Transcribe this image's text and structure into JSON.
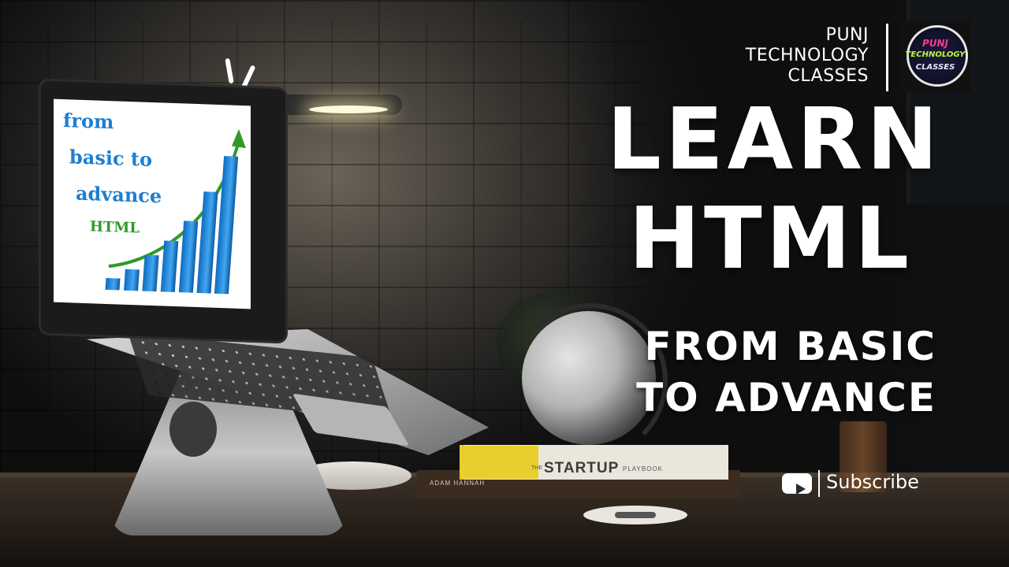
{
  "brand": {
    "lines": [
      "PUNJ",
      "TECHNOLOGY",
      "CLASSES"
    ],
    "logo_lines": [
      "PUNJ",
      "TECHNOLOGY",
      "CLASSES"
    ]
  },
  "headline": {
    "line1": "LEARN",
    "line2": "HTML",
    "sub1": "FROM BASIC",
    "sub2": "TO ADVANCE"
  },
  "laptop_screen": {
    "line1": "from",
    "line2": "basic to",
    "line3": "advance",
    "tag": "HTML",
    "bar_levels": [
      0.08,
      0.14,
      0.24,
      0.34,
      0.48,
      0.68,
      0.92
    ]
  },
  "books": {
    "top_pre": "THE",
    "top_title": "STARTUP",
    "top_sub": "PLAYBOOK",
    "bottom_author": "ADAM HANNAH"
  },
  "subscribe": {
    "label": "Subscribe",
    "icon": "youtube-play-icon"
  },
  "colors": {
    "screen_text": "#1d7fd0",
    "screen_html_tag": "#2e9a2a",
    "headline": "#ffffff"
  }
}
